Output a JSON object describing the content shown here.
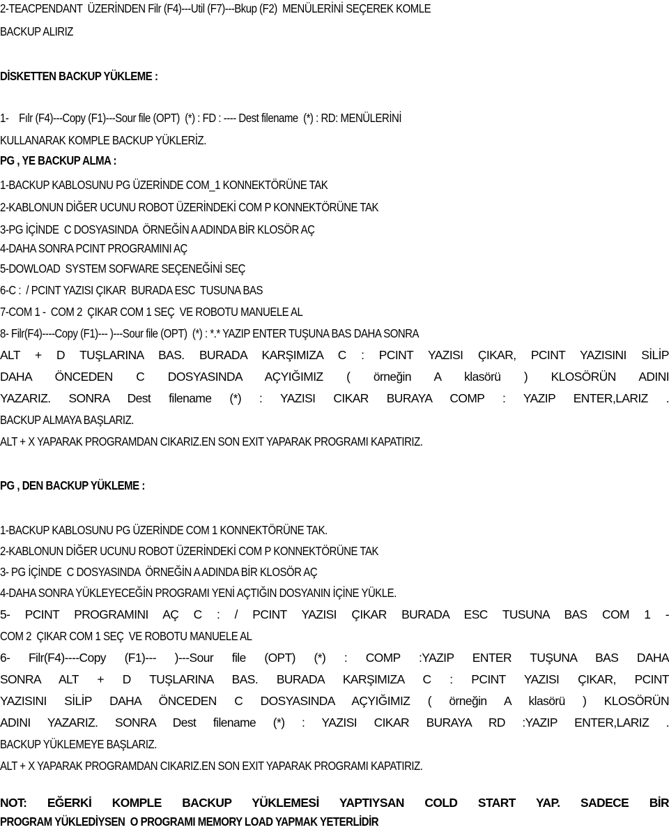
{
  "document": {
    "intro": {
      "lines": [
        "2-TEACPENDANT  ÜZERİNDEN Filr (F4)---Util (F7)---Bkup (F2)  MENÜLERİNİ SEÇEREK KOMLE",
        "BACKUP ALIRIZ"
      ]
    },
    "floppy_section": {
      "heading": "DİSKETTEN BACKUP YÜKLEME :",
      "lines": [
        "1-    Fılr (F4)---Copy (F1)---Sour file (OPT)  (*) : FD : ---- Dest filename  (*) : RD: MENÜLERİNİ",
        "KULLANARAK KOMPLE BACKUP YÜKLERİZ."
      ]
    },
    "pg_backup_section": {
      "heading": "PG , YE BACKUP ALMA :",
      "lines": [
        "1-BACKUP KABLOSUNU PG ÜZERİNDE COM_1 KONNEKTÖRÜNE TAK",
        "2-KABLONUN DİĞER UCUNU ROBOT ÜZERİNDEKİ COM P KONNEKTÖRÜNE TAK",
        "3-PG İÇİNDE  C DOSYASINDA  ÖRNEĞİN A ADINDA BİR KLOSÖR AÇ",
        "4-DAHA SONRA PCINT PROGRAMINI AÇ",
        "5-DOWLOAD  SYSTEM SOFWARE SEÇENEĞİNİ SEÇ",
        "6-C :  / PCINT YAZISI ÇIKAR  BURADA ESC  TUSUNA BAS",
        "7-COM 1 -  COM 2  ÇIKAR COM 1 SEÇ  VE ROBOTU MANUELE AL",
        "8- Filr(F4)----Copy (F1)--- )---Sour file (OPT)  (*) : *.* YAZIP ENTER TUŞUNA BAS DAHA SONRA",
        "ALT + D TUŞLARINA BAS.  BURADA KARŞIMIZA C : PCINT YAZISI ÇIKAR, PCINT YAZISINI SİLİP",
        "DAHA ÖNCEDEN C  DOSYASINDA AÇYIĞIMIZ  ( örneğin A klasörü )  KLOSÖRÜN ADINI",
        "YAZARIZ. SONRA  Dest filename  (*) : YAZISI CIKAR BURAYA  COMP :  YAZIP ENTER,LARIZ .",
        "BACKUP ALMAYA BAŞLARIZ.",
        "ALT + X YAPARAK PROGRAMDAN CIKARIZ.EN SON EXIT YAPARAK PROGRAMI KAPATIRIZ."
      ]
    },
    "pg_load_section": {
      "heading": "PG , DEN BACKUP YÜKLEME :",
      "lines": [
        "1-BACKUP KABLOSUNU PG ÜZERİNDE COM 1 KONNEKTÖRÜNE TAK.",
        "2-KABLONUN DİĞER UCUNU ROBOT ÜZERİNDEKİ COM P KONNEKTÖRÜNE TAK",
        "3- PG İÇİNDE  C DOSYASINDA  ÖRNEĞİN A ADINDA BİR KLOSÖR AÇ",
        "4-DAHA SONRA YÜKLEYECEĞİN PROGRAMI YENİ AÇTIĞIN DOSYANIN İÇİNE YÜKLE.",
        "5- PCINT PROGRAMINI AÇ  C :  / PCINT YAZISI ÇIKAR  BURADA ESC  TUSUNA BAS  COM 1 -",
        "COM 2  ÇIKAR COM 1 SEÇ  VE ROBOTU MANUELE AL",
        "6- Filr(F4)----Copy (F1)--- )---Sour file (OPT)  (*) : COMP :YAZIP ENTER TUŞUNA BAS DAHA",
        "SONRA  ALT + D TUŞLARINA BAS.  BURADA KARŞIMIZA C : PCINT YAZISI ÇIKAR, PCINT",
        "YAZISINI SİLİP  DAHA ÖNCEDEN C  DOSYASINDA AÇYIĞIMIZ  ( örneğin A klasörü )  KLOSÖRÜN",
        "ADINI  YAZARIZ. SONRA  Dest filename  (*) : YAZISI CIKAR BURAYA  RD :YAZIP ENTER,LARIZ .",
        "BACKUP YÜKLEMEYE BAŞLARIZ.",
        "ALT + X YAPARAK PROGRAMDAN CIKARIZ.EN SON EXIT YAPARAK PROGRAMI KAPATIRIZ."
      ]
    },
    "note": {
      "lines": [
        "NOT: EĞERKİ KOMPLE BACKUP YÜKLEMESİ YAPTIYSAN COLD START YAP. SADECE BİR",
        "PROGRAM YÜKLEDİYSEN  O PROGRAMI MEMORY LOAD YAPMAK YETERLİDİR"
      ]
    }
  }
}
